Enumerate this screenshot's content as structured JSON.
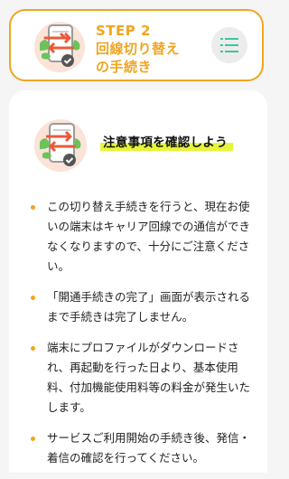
{
  "step": {
    "label": "STEP 2",
    "title_line1": "回線切り替え",
    "title_line2": "の手続き",
    "accent_color": "#f0a520"
  },
  "menu": {
    "icon": "list-menu-icon"
  },
  "caution": {
    "heading": "注意事項を確認しよう",
    "highlight_color": "#e6f53a",
    "items": [
      "この切り替え手続きを行うと、現在お使いの端末はキャリア回線での通信ができなくなりますので、十分にご注意ください。",
      "「開通手続きの完了」画面が表示されるまで手続きは完了しません。",
      "端末にプロファイルがダウンロードされ、再起動を行った日より、基本使用料、付加機能使用料等の料金が発生いたします。",
      "サービスご利用開始の手続き後、発信・着信の確認を行ってください。"
    ]
  }
}
